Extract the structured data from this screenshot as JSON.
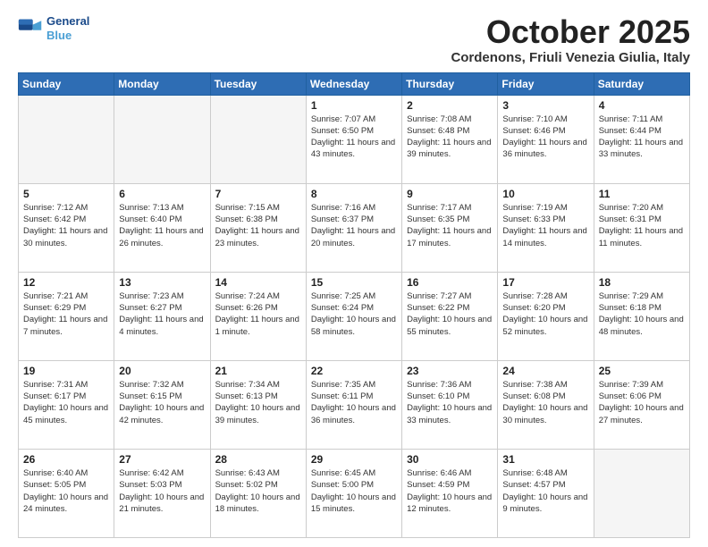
{
  "header": {
    "logo_line1": "General",
    "logo_line2": "Blue",
    "month": "October 2025",
    "location": "Cordenons, Friuli Venezia Giulia, Italy"
  },
  "days_of_week": [
    "Sunday",
    "Monday",
    "Tuesday",
    "Wednesday",
    "Thursday",
    "Friday",
    "Saturday"
  ],
  "weeks": [
    [
      {
        "day": "",
        "info": ""
      },
      {
        "day": "",
        "info": ""
      },
      {
        "day": "",
        "info": ""
      },
      {
        "day": "1",
        "info": "Sunrise: 7:07 AM\nSunset: 6:50 PM\nDaylight: 11 hours and 43 minutes."
      },
      {
        "day": "2",
        "info": "Sunrise: 7:08 AM\nSunset: 6:48 PM\nDaylight: 11 hours and 39 minutes."
      },
      {
        "day": "3",
        "info": "Sunrise: 7:10 AM\nSunset: 6:46 PM\nDaylight: 11 hours and 36 minutes."
      },
      {
        "day": "4",
        "info": "Sunrise: 7:11 AM\nSunset: 6:44 PM\nDaylight: 11 hours and 33 minutes."
      }
    ],
    [
      {
        "day": "5",
        "info": "Sunrise: 7:12 AM\nSunset: 6:42 PM\nDaylight: 11 hours and 30 minutes."
      },
      {
        "day": "6",
        "info": "Sunrise: 7:13 AM\nSunset: 6:40 PM\nDaylight: 11 hours and 26 minutes."
      },
      {
        "day": "7",
        "info": "Sunrise: 7:15 AM\nSunset: 6:38 PM\nDaylight: 11 hours and 23 minutes."
      },
      {
        "day": "8",
        "info": "Sunrise: 7:16 AM\nSunset: 6:37 PM\nDaylight: 11 hours and 20 minutes."
      },
      {
        "day": "9",
        "info": "Sunrise: 7:17 AM\nSunset: 6:35 PM\nDaylight: 11 hours and 17 minutes."
      },
      {
        "day": "10",
        "info": "Sunrise: 7:19 AM\nSunset: 6:33 PM\nDaylight: 11 hours and 14 minutes."
      },
      {
        "day": "11",
        "info": "Sunrise: 7:20 AM\nSunset: 6:31 PM\nDaylight: 11 hours and 11 minutes."
      }
    ],
    [
      {
        "day": "12",
        "info": "Sunrise: 7:21 AM\nSunset: 6:29 PM\nDaylight: 11 hours and 7 minutes."
      },
      {
        "day": "13",
        "info": "Sunrise: 7:23 AM\nSunset: 6:27 PM\nDaylight: 11 hours and 4 minutes."
      },
      {
        "day": "14",
        "info": "Sunrise: 7:24 AM\nSunset: 6:26 PM\nDaylight: 11 hours and 1 minute."
      },
      {
        "day": "15",
        "info": "Sunrise: 7:25 AM\nSunset: 6:24 PM\nDaylight: 10 hours and 58 minutes."
      },
      {
        "day": "16",
        "info": "Sunrise: 7:27 AM\nSunset: 6:22 PM\nDaylight: 10 hours and 55 minutes."
      },
      {
        "day": "17",
        "info": "Sunrise: 7:28 AM\nSunset: 6:20 PM\nDaylight: 10 hours and 52 minutes."
      },
      {
        "day": "18",
        "info": "Sunrise: 7:29 AM\nSunset: 6:18 PM\nDaylight: 10 hours and 48 minutes."
      }
    ],
    [
      {
        "day": "19",
        "info": "Sunrise: 7:31 AM\nSunset: 6:17 PM\nDaylight: 10 hours and 45 minutes."
      },
      {
        "day": "20",
        "info": "Sunrise: 7:32 AM\nSunset: 6:15 PM\nDaylight: 10 hours and 42 minutes."
      },
      {
        "day": "21",
        "info": "Sunrise: 7:34 AM\nSunset: 6:13 PM\nDaylight: 10 hours and 39 minutes."
      },
      {
        "day": "22",
        "info": "Sunrise: 7:35 AM\nSunset: 6:11 PM\nDaylight: 10 hours and 36 minutes."
      },
      {
        "day": "23",
        "info": "Sunrise: 7:36 AM\nSunset: 6:10 PM\nDaylight: 10 hours and 33 minutes."
      },
      {
        "day": "24",
        "info": "Sunrise: 7:38 AM\nSunset: 6:08 PM\nDaylight: 10 hours and 30 minutes."
      },
      {
        "day": "25",
        "info": "Sunrise: 7:39 AM\nSunset: 6:06 PM\nDaylight: 10 hours and 27 minutes."
      }
    ],
    [
      {
        "day": "26",
        "info": "Sunrise: 6:40 AM\nSunset: 5:05 PM\nDaylight: 10 hours and 24 minutes."
      },
      {
        "day": "27",
        "info": "Sunrise: 6:42 AM\nSunset: 5:03 PM\nDaylight: 10 hours and 21 minutes."
      },
      {
        "day": "28",
        "info": "Sunrise: 6:43 AM\nSunset: 5:02 PM\nDaylight: 10 hours and 18 minutes."
      },
      {
        "day": "29",
        "info": "Sunrise: 6:45 AM\nSunset: 5:00 PM\nDaylight: 10 hours and 15 minutes."
      },
      {
        "day": "30",
        "info": "Sunrise: 6:46 AM\nSunset: 4:59 PM\nDaylight: 10 hours and 12 minutes."
      },
      {
        "day": "31",
        "info": "Sunrise: 6:48 AM\nSunset: 4:57 PM\nDaylight: 10 hours and 9 minutes."
      },
      {
        "day": "",
        "info": ""
      }
    ]
  ]
}
